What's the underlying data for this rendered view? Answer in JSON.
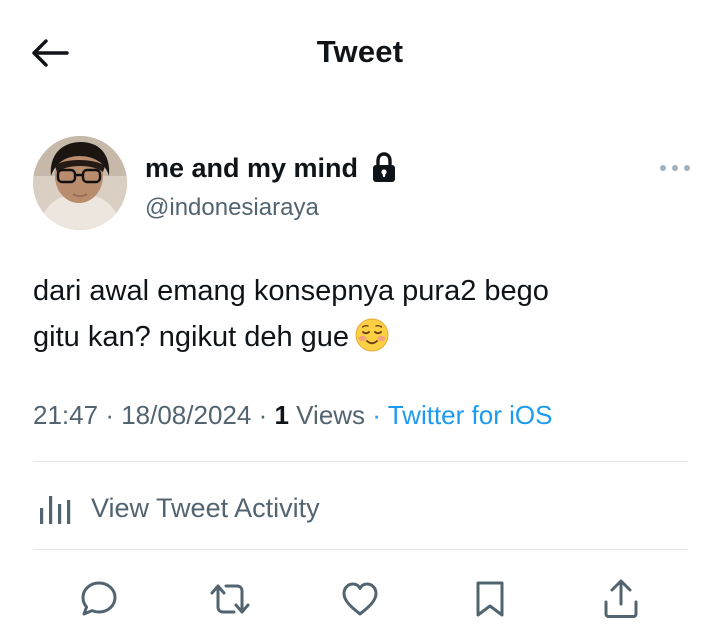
{
  "header": {
    "title": "Tweet",
    "back_icon": "arrow-left-icon"
  },
  "tweet": {
    "author": {
      "display_name": "me and my mind",
      "handle": "@indonesiaraya",
      "protected_icon": "lock-icon"
    },
    "text_lines": [
      "dari awal emang konsepnya pura2 bego",
      "gitu kan? ngikut deh gue"
    ],
    "emoji": "smiling-face-icon",
    "time": "21:47",
    "date": "18/08/2024",
    "views_count": "1",
    "views_label": "Views",
    "source": "Twitter for iOS"
  },
  "activity": {
    "label": "View Tweet Activity",
    "icon": "bar-chart-icon"
  },
  "actions": [
    {
      "name": "reply",
      "icon": "reply-icon"
    },
    {
      "name": "retweet",
      "icon": "retweet-icon"
    },
    {
      "name": "like",
      "icon": "heart-icon"
    },
    {
      "name": "bookmark",
      "icon": "bookmark-icon"
    },
    {
      "name": "share",
      "icon": "share-icon"
    }
  ],
  "colors": {
    "text_primary": "#0f1419",
    "text_secondary": "#536471",
    "link": "#1d9bf0",
    "divider": "#e1e5e8"
  }
}
